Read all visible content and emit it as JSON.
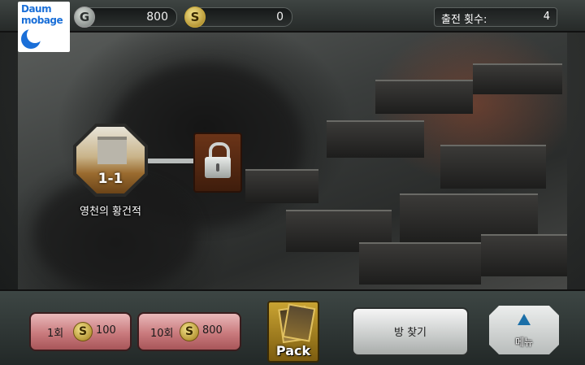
{
  "header": {
    "gold": {
      "icon": "G",
      "value": "800"
    },
    "silver": {
      "icon": "S",
      "value": "0"
    },
    "sortie": {
      "label": "출전 횟수:",
      "value": "4"
    }
  },
  "logo": {
    "line1": "Daum",
    "line2": "mobage"
  },
  "map": {
    "stage": {
      "number": "1-1",
      "name": "영천의 황건적"
    },
    "locked_stage": {
      "icon": "lock-icon"
    }
  },
  "bottom": {
    "gacha1": {
      "count": "1회",
      "coin": "S",
      "amount": "100"
    },
    "gacha10": {
      "count": "10회",
      "coin": "S",
      "amount": "800"
    },
    "pack": {
      "label": "Pack"
    },
    "find_room": {
      "label": "방 찾기"
    },
    "menu": {
      "label": "메뉴",
      "icon": "triangle-up-icon"
    }
  },
  "colors": {
    "gacha_button": "#c97a7d",
    "menu_arrow": "#1b6fa8",
    "coin_gold": "#c8a83a"
  }
}
